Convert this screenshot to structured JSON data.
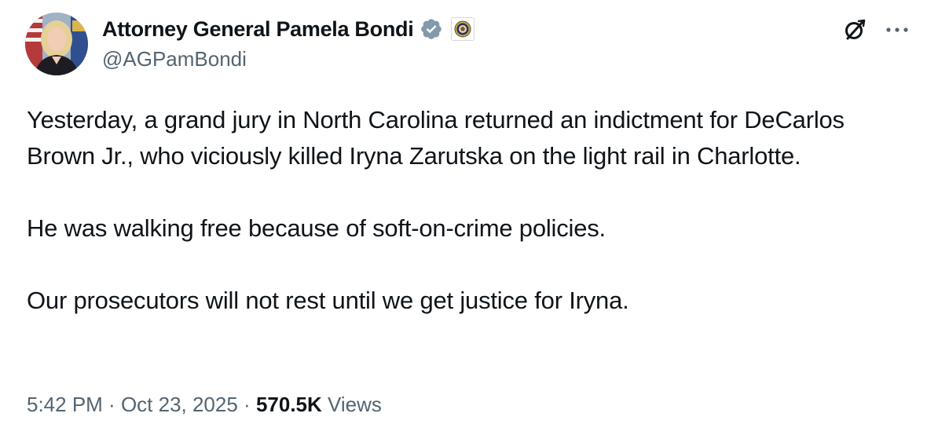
{
  "author": {
    "display_name": "Attorney General Pamela Bondi",
    "handle": "@AGPamBondi",
    "verified_icon": "verified-badge-icon",
    "affiliate_icon": "doj-seal-icon"
  },
  "actions": {
    "grok_icon": "grok-icon",
    "more_icon": "more-icon"
  },
  "tweet": {
    "paragraphs": [
      "Yesterday, a grand jury in North Carolina returned an indictment for DeCarlos Brown Jr., who viciously killed Iryna Zarutska on the light rail in Charlotte.",
      "He was walking free because of soft-on-crime policies.",
      "Our prosecutors will not rest until we get justice for Iryna."
    ]
  },
  "meta": {
    "time": "5:42 PM",
    "separator1": " · ",
    "date": "Oct 23, 2025",
    "separator2": " · ",
    "views_count": "570.5K",
    "views_label": " Views"
  },
  "colors": {
    "text_primary": "#0f1419",
    "text_secondary": "#536471",
    "verified_blue": "#829aab"
  }
}
